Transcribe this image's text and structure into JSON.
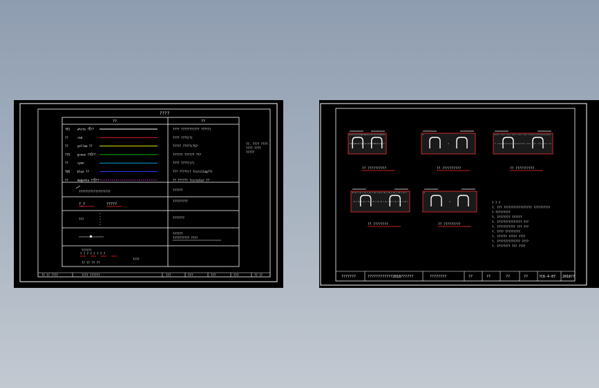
{
  "left_sheet": {
    "title": "????",
    "col1_header": "??",
    "col2_header": "??",
    "layers": [
      {
        "code": "?01",
        "name": "white ?Ǖ??",
        "color": "#ffffff",
        "desc": "???? ???????(??? ?????)"
      },
      {
        "code": "??",
        "name": "red",
        "color": "#ff2020",
        "desc": "???? ????(?)"
      },
      {
        "code": "??",
        "name": "yellow ??",
        "color": "#ffff00",
        "desc": "????? ?????(?S?"
      },
      {
        "code": "?75",
        "name": "green ??Ǖ??",
        "color": "#00d000",
        "desc": "?????? ?????? ???"
      },
      {
        "code": "??",
        "name": "cyan",
        "color": "#00c0ff",
        "desc": "???? ?????(?)"
      },
      {
        "code": "?05",
        "name": "blue ??",
        "color": "#2040ff",
        "desc": "??? ?????(? ?circling??)"
      },
      {
        "code": "??",
        "name": "magenta ??Ǖ??",
        "color": "#ff40ff",
        "desc": "??   ?????? ?circular ??"
      }
    ],
    "side_note": [
      "??, ????  ????",
      "???? ????",
      "?????"
    ],
    "row2_right": "??????",
    "row2_left_text": "???????????????????",
    "row3_left_a": "?_?",
    "row3_left_b": "?????",
    "row3_right": "?????????",
    "row4_right": "???????",
    "row5_right_a": "??????",
    "row5_right_b": "?????????? ????",
    "row6_left_note": "??????",
    "row6_left_stamp": "????",
    "titleblock": [
      "?? ?? ????",
      "???? ??????",
      "???",
      "???",
      "???",
      "???",
      "?? ??"
    ]
  },
  "right_sheet": {
    "sections": [
      "?? ??????????",
      "?? ??????????",
      "?? ??????????",
      "?? ????????",
      "?? ?????????"
    ],
    "notes": [
      "? ? ?",
      "?. ??? ????????????????? ??????????",
      "  ? ?????????",
      "?. ???????? ??????",
      "?. ??????????????? ???",
      "?. ??????????? ??? ???",
      "?. ???? ?????????",
      "?. ?????? ????? ????",
      "?. ?????????????? ????",
      "?. ???????? ??? ????"
    ],
    "titleblock": [
      "???????",
      "????????????2018??????",
      "????????",
      "??",
      "??",
      "??",
      "??",
      "?C6-4-07",
      "2018??"
    ]
  }
}
